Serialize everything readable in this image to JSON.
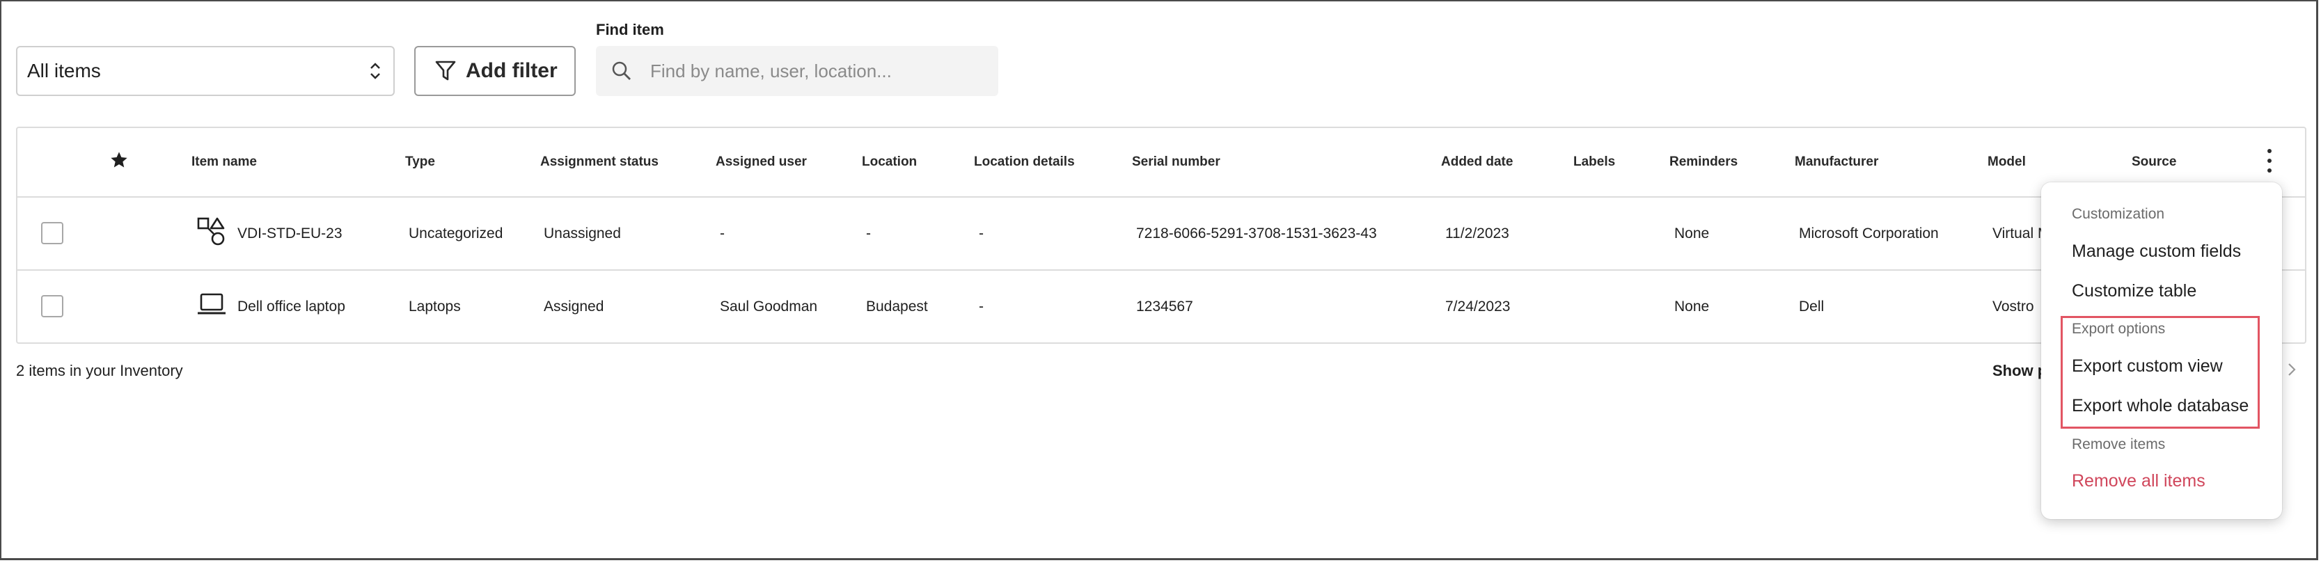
{
  "toolbar": {
    "view_select": "All items",
    "add_filter": "Add filter",
    "find_label": "Find item",
    "search_placeholder": "Find by name, user, location...",
    "search_value": ""
  },
  "table": {
    "columns": [
      "Item name",
      "Type",
      "Assignment status",
      "Assigned user",
      "Location",
      "Location details",
      "Serial number",
      "Added date",
      "Labels",
      "Reminders",
      "Manufacturer",
      "Model",
      "Source"
    ],
    "rows": [
      {
        "icon": "shapes-icon",
        "name": "VDI-STD-EU-23",
        "type": "Uncategorized",
        "status": "Unassigned",
        "user": "-",
        "location": "-",
        "location_details": "-",
        "serial": "7218-6066-5291-3708-1531-3623-43",
        "added": "11/2/2023",
        "labels": "",
        "reminders": "None",
        "manufacturer": "Microsoft Corporation",
        "model": "Virtual M",
        "source": ""
      },
      {
        "icon": "laptop-icon",
        "name": "Dell office laptop",
        "type": "Laptops",
        "status": "Assigned",
        "user": "Saul Goodman",
        "location": "Budapest",
        "location_details": "-",
        "serial": "1234567",
        "added": "7/24/2023",
        "labels": "",
        "reminders": "None",
        "manufacturer": "Dell",
        "model": "Vostro",
        "source": ""
      }
    ]
  },
  "footer": {
    "count_text": "2 items in your Inventory",
    "show_per_page": "Show p"
  },
  "menu": {
    "customization_header": "Customization",
    "manage_custom_fields": "Manage custom fields",
    "customize_table": "Customize table",
    "export_header": "Export options",
    "export_custom_view": "Export custom view",
    "export_whole_database": "Export whole database",
    "remove_header": "Remove items",
    "remove_all_items": "Remove all items"
  },
  "colors": {
    "danger": "#d0465b",
    "highlight": "#e25563",
    "border": "#dcdcdc"
  }
}
